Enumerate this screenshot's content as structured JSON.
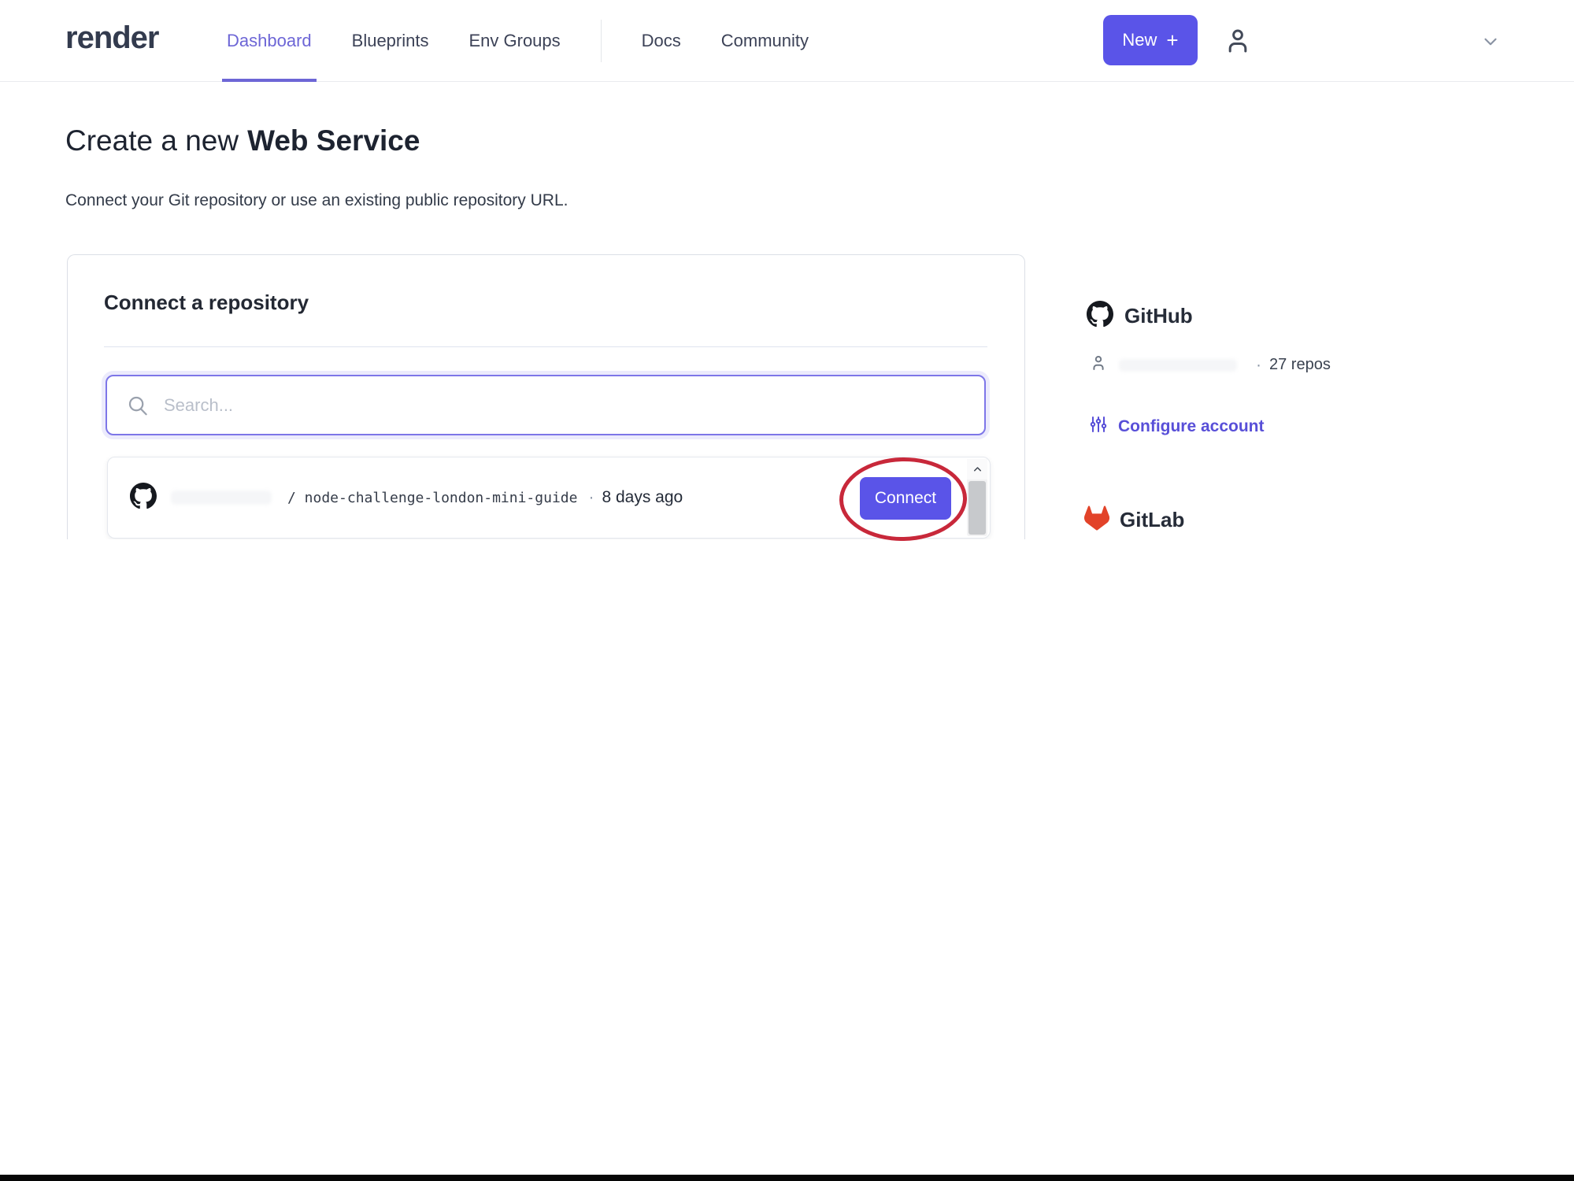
{
  "nav": {
    "logo": "render",
    "items": [
      {
        "label": "Dashboard",
        "active": true
      },
      {
        "label": "Blueprints",
        "active": false
      },
      {
        "label": "Env Groups",
        "active": false
      },
      {
        "label": "Docs",
        "active": false
      },
      {
        "label": "Community",
        "active": false
      }
    ],
    "new_button_label": "New",
    "new_button_plus": "+"
  },
  "page": {
    "title_regular": "Create a new",
    "title_bold": "Web Service",
    "subtitle": "Connect your Git repository or use an existing public repository URL."
  },
  "card": {
    "heading": "Connect a repository",
    "search_placeholder": "Search...",
    "repo": {
      "path": "/ node-challenge-london-mini-guide",
      "separator": "·",
      "updated": "8 days ago",
      "connect_label": "Connect"
    }
  },
  "sidebar": {
    "github": {
      "title": "GitHub",
      "separator": "·",
      "repos_count": "27 repos",
      "configure_label": "Configure account"
    },
    "gitlab": {
      "title": "GitLab"
    }
  },
  "colors": {
    "accent": "#5a54e8",
    "nav_active": "#6d66d6",
    "link": "#584fd8",
    "annotation_red": "#c8283a",
    "gitlab_orange": "#e24329"
  }
}
